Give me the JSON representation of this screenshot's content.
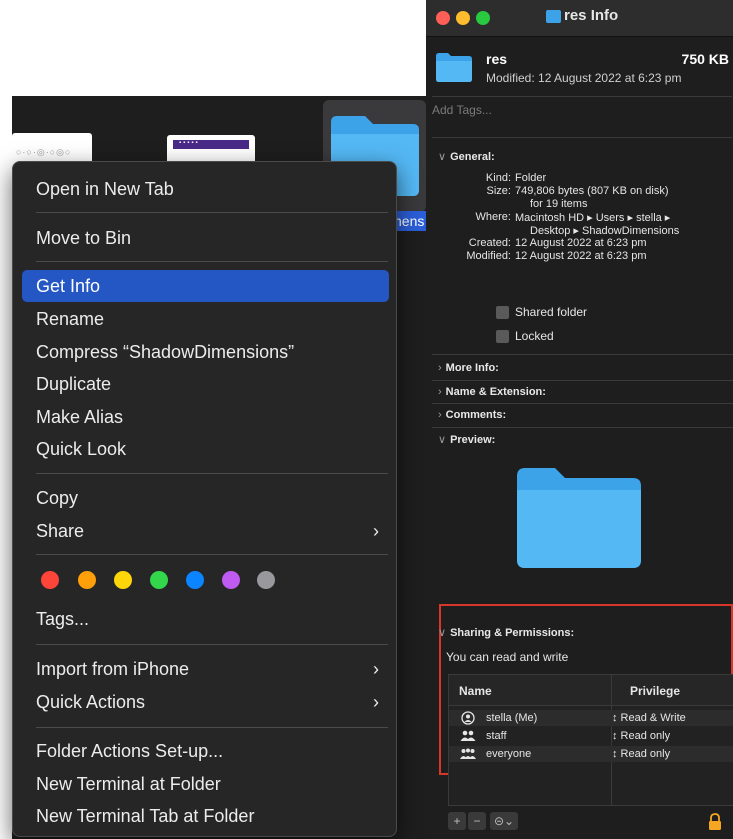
{
  "finder": {
    "thumb1_text": "○·○·◎·○◎○",
    "thumb2_text": "▪▪▪▪▪",
    "selected_label_peek": "hens"
  },
  "context_menu": {
    "items": {
      "open_new_tab": "Open in New Tab",
      "move_to_bin": "Move to Bin",
      "get_info": "Get Info",
      "rename": "Rename",
      "compress": "Compress “ShadowDimensions”",
      "duplicate": "Duplicate",
      "make_alias": "Make Alias",
      "quick_look": "Quick Look",
      "copy": "Copy",
      "share": "Share",
      "tags": "Tags...",
      "import_iphone": "Import from iPhone",
      "quick_actions": "Quick Actions",
      "folder_actions": "Folder Actions Set-up...",
      "new_terminal": "New Terminal at Folder",
      "new_terminal_tab": "New Terminal Tab at Folder"
    },
    "highlighted": "get_info",
    "tag_colors": [
      "#ff453a",
      "#ff9f0a",
      "#ffd60a",
      "#32d74b",
      "#0a84ff",
      "#bf5af2",
      "#98989d"
    ],
    "chevron": "›"
  },
  "info_window": {
    "title": "res Info",
    "traffic_colors": [
      "#ff5f57",
      "#febc2e",
      "#28c840"
    ],
    "accent": "#3da3e8",
    "header": {
      "name": "res",
      "size": "750 KB",
      "modified": "Modified: 12 August 2022 at 6:23 pm"
    },
    "tags_placeholder": "Add Tags...",
    "general": {
      "heading": "General:",
      "kind_label": "Kind:",
      "kind": "Folder",
      "size_label": "Size:",
      "size_line1": "749,806 bytes (807 KB on disk)",
      "size_line2": "for 19 items",
      "where_label": "Where:",
      "where_line1": "Macintosh HD ▸ Users ▸ stella ▸",
      "where_line2": "Desktop ▸ ShadowDimensions",
      "created_label": "Created:",
      "created": "12 August 2022 at 6:23 pm",
      "modified_label": "Modified:",
      "modified": "12 August 2022 at 6:23 pm",
      "shared_folder": "Shared folder",
      "locked": "Locked"
    },
    "sections": {
      "more_info": "More Info:",
      "name_extension": "Name & Extension:",
      "comments": "Comments:",
      "preview": "Preview:",
      "sharing": "Sharing & Permissions:"
    },
    "sharing": {
      "summary": "You can read and write",
      "col_name": "Name",
      "col_privilege": "Privilege",
      "rows": [
        {
          "name": "stella (Me)",
          "privilege": "↕ Read & Write",
          "icon": "user-circle-icon"
        },
        {
          "name": "staff",
          "privilege": "↕ Read only",
          "icon": "group-icon"
        },
        {
          "name": "everyone",
          "privilege": "↕ Read only",
          "icon": "everyone-icon"
        }
      ]
    },
    "bottom": {
      "add": "+",
      "remove": "−",
      "actions": "⊝⌄"
    },
    "arrows": {
      "open": "∨",
      "closed": "›"
    }
  }
}
